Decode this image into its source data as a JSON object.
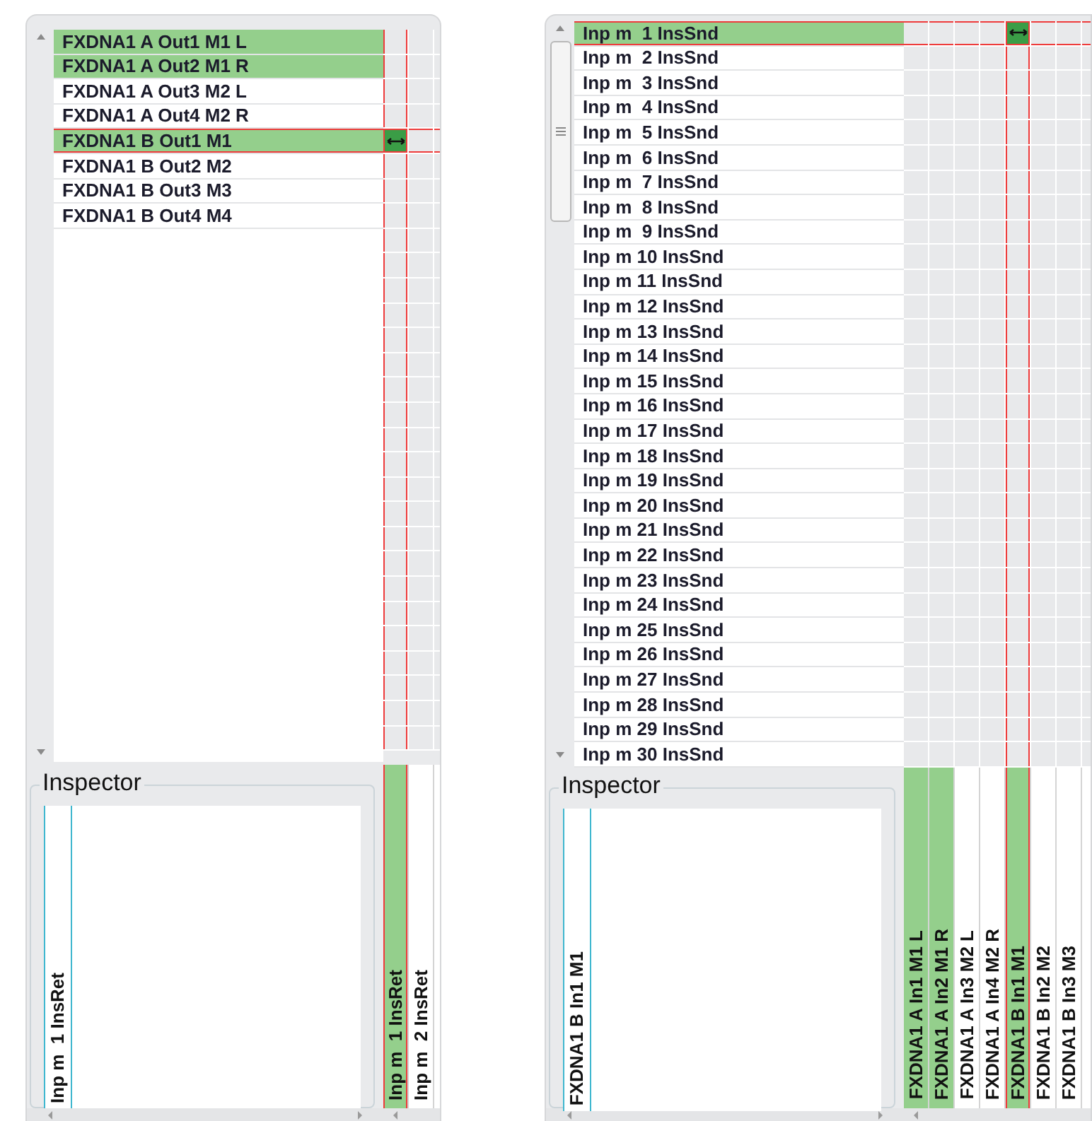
{
  "panels": [
    {
      "rows": [
        {
          "label": "FXDNA1 A Out1 M1 L",
          "highlighted": true,
          "selected": false,
          "connected": false
        },
        {
          "label": "FXDNA1 A Out2 M1 R",
          "highlighted": true,
          "selected": false,
          "connected": false
        },
        {
          "label": "FXDNA1 A Out3 M2 L",
          "highlighted": false,
          "selected": false,
          "connected": false
        },
        {
          "label": "FXDNA1 A Out4 M2 R",
          "highlighted": false,
          "selected": false,
          "connected": false
        },
        {
          "label": "FXDNA1 B Out1 M1",
          "highlighted": true,
          "selected": true,
          "connected": true
        },
        {
          "label": "FXDNA1 B Out2 M2",
          "highlighted": false,
          "selected": false,
          "connected": false
        },
        {
          "label": "FXDNA1 B Out3 M3",
          "highlighted": false,
          "selected": false,
          "connected": false
        },
        {
          "label": "FXDNA1 B Out4 M4",
          "highlighted": false,
          "selected": false,
          "connected": false
        }
      ],
      "columns": [
        {
          "label": "Inp m  1 InsRet",
          "highlighted": true,
          "selected": true,
          "connected": true
        },
        {
          "label": "Inp m  2 InsRet",
          "highlighted": false,
          "selected": false,
          "connected": false
        }
      ],
      "inspector": {
        "title": "Inspector",
        "label": "Inp m  1 InsRet"
      }
    },
    {
      "rows": [
        {
          "label": "Inp m  1 InsSnd",
          "highlighted": true,
          "selected": true,
          "connected": true
        },
        {
          "label": "Inp m  2 InsSnd",
          "highlighted": false,
          "selected": false,
          "connected": false
        },
        {
          "label": "Inp m  3 InsSnd",
          "highlighted": false,
          "selected": false,
          "connected": false
        },
        {
          "label": "Inp m  4 InsSnd",
          "highlighted": false,
          "selected": false,
          "connected": false
        },
        {
          "label": "Inp m  5 InsSnd",
          "highlighted": false,
          "selected": false,
          "connected": false
        },
        {
          "label": "Inp m  6 InsSnd",
          "highlighted": false,
          "selected": false,
          "connected": false
        },
        {
          "label": "Inp m  7 InsSnd",
          "highlighted": false,
          "selected": false,
          "connected": false
        },
        {
          "label": "Inp m  8 InsSnd",
          "highlighted": false,
          "selected": false,
          "connected": false
        },
        {
          "label": "Inp m  9 InsSnd",
          "highlighted": false,
          "selected": false,
          "connected": false
        },
        {
          "label": "Inp m 10 InsSnd",
          "highlighted": false,
          "selected": false,
          "connected": false
        },
        {
          "label": "Inp m 11 InsSnd",
          "highlighted": false,
          "selected": false,
          "connected": false
        },
        {
          "label": "Inp m 12 InsSnd",
          "highlighted": false,
          "selected": false,
          "connected": false
        },
        {
          "label": "Inp m 13 InsSnd",
          "highlighted": false,
          "selected": false,
          "connected": false
        },
        {
          "label": "Inp m 14 InsSnd",
          "highlighted": false,
          "selected": false,
          "connected": false
        },
        {
          "label": "Inp m 15 InsSnd",
          "highlighted": false,
          "selected": false,
          "connected": false
        },
        {
          "label": "Inp m 16 InsSnd",
          "highlighted": false,
          "selected": false,
          "connected": false
        },
        {
          "label": "Inp m 17 InsSnd",
          "highlighted": false,
          "selected": false,
          "connected": false
        },
        {
          "label": "Inp m 18 InsSnd",
          "highlighted": false,
          "selected": false,
          "connected": false
        },
        {
          "label": "Inp m 19 InsSnd",
          "highlighted": false,
          "selected": false,
          "connected": false
        },
        {
          "label": "Inp m 20 InsSnd",
          "highlighted": false,
          "selected": false,
          "connected": false
        },
        {
          "label": "Inp m 21 InsSnd",
          "highlighted": false,
          "selected": false,
          "connected": false
        },
        {
          "label": "Inp m 22 InsSnd",
          "highlighted": false,
          "selected": false,
          "connected": false
        },
        {
          "label": "Inp m 23 InsSnd",
          "highlighted": false,
          "selected": false,
          "connected": false
        },
        {
          "label": "Inp m 24 InsSnd",
          "highlighted": false,
          "selected": false,
          "connected": false
        },
        {
          "label": "Inp m 25 InsSnd",
          "highlighted": false,
          "selected": false,
          "connected": false
        },
        {
          "label": "Inp m 26 InsSnd",
          "highlighted": false,
          "selected": false,
          "connected": false
        },
        {
          "label": "Inp m 27 InsSnd",
          "highlighted": false,
          "selected": false,
          "connected": false
        },
        {
          "label": "Inp m 28 InsSnd",
          "highlighted": false,
          "selected": false,
          "connected": false
        },
        {
          "label": "Inp m 29 InsSnd",
          "highlighted": false,
          "selected": false,
          "connected": false
        },
        {
          "label": "Inp m 30 InsSnd",
          "highlighted": false,
          "selected": false,
          "connected": false
        }
      ],
      "columns": [
        {
          "label": "FXDNA1 A In1 M1 L",
          "highlighted": true,
          "selected": false,
          "connected": false
        },
        {
          "label": "FXDNA1 A In2 M1 R",
          "highlighted": true,
          "selected": false,
          "connected": false
        },
        {
          "label": "FXDNA1 A In3 M2 L",
          "highlighted": false,
          "selected": false,
          "connected": false
        },
        {
          "label": "FXDNA1 A In4 M2 R",
          "highlighted": false,
          "selected": false,
          "connected": false
        },
        {
          "label": "FXDNA1 B In1 M1",
          "highlighted": true,
          "selected": true,
          "connected": true
        },
        {
          "label": "FXDNA1 B In2 M2",
          "highlighted": false,
          "selected": false,
          "connected": false
        },
        {
          "label": "FXDNA1 B In3 M3",
          "highlighted": false,
          "selected": false,
          "connected": false
        }
      ],
      "inspector": {
        "title": "Inspector",
        "label": "FXDNA1 B In1 M1"
      }
    }
  ]
}
